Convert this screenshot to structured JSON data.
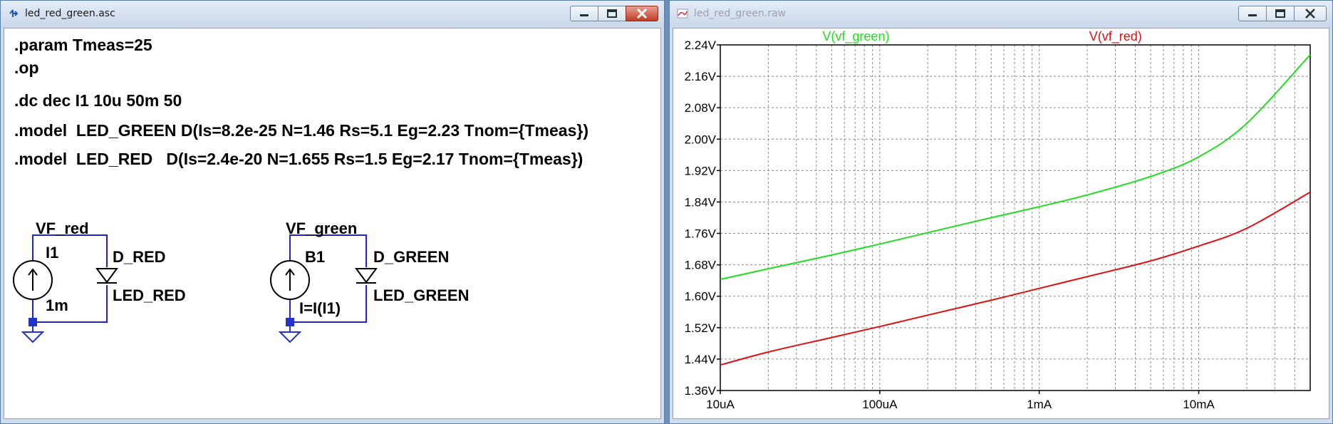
{
  "schematic_window": {
    "title": "led_red_green.asc",
    "directives": [
      ".param Tmeas=25",
      ".op",
      ".dc dec I1 10u 50m 50",
      ".model  LED_GREEN D(Is=8.2e-25 N=1.46 Rs=5.1 Eg=2.23 Tnom={Tmeas})",
      ".model  LED_RED   D(Is=2.4e-20 N=1.655 Rs=1.5 Eg=2.17 Tnom={Tmeas})"
    ],
    "circuit_red": {
      "net_label": "VF_red",
      "source_name": "I1",
      "source_value": "1m",
      "diode_name": "D_RED",
      "diode_model": "LED_RED"
    },
    "circuit_green": {
      "net_label": "VF_green",
      "source_name": "B1",
      "source_value": "I=I(I1)",
      "diode_name": "D_GREEN",
      "diode_model": "LED_GREEN"
    },
    "wire_color": "#2222cc"
  },
  "plot_window": {
    "title": "led_red_green.raw"
  },
  "chart_data": {
    "type": "line",
    "xscale": "log",
    "xlim": [
      1e-05,
      0.05
    ],
    "ylim": [
      1.36,
      2.24
    ],
    "xticks": [
      1e-05,
      0.0001,
      0.001,
      0.01
    ],
    "xtick_labels": [
      "10uA",
      "100uA",
      "1mA",
      "10mA"
    ],
    "yticks": [
      1.36,
      1.44,
      1.52,
      1.6,
      1.68,
      1.76,
      1.84,
      1.92,
      2.0,
      2.08,
      2.16,
      2.24
    ],
    "ytick_labels": [
      "1.36V",
      "1.44V",
      "1.52V",
      "1.60V",
      "1.68V",
      "1.76V",
      "1.84V",
      "1.92V",
      "2.00V",
      "2.08V",
      "2.16V",
      "2.24V"
    ],
    "grid": true,
    "series": [
      {
        "name": "V(vf_green)",
        "color": "#22dd22",
        "x": [
          1e-05,
          2e-05,
          5e-05,
          0.0001,
          0.0002,
          0.0005,
          0.001,
          0.002,
          0.005,
          0.01,
          0.02,
          0.05
        ],
        "y": [
          1.643,
          1.67,
          1.705,
          1.733,
          1.762,
          1.8,
          1.828,
          1.858,
          1.905,
          1.955,
          2.04,
          2.215
        ]
      },
      {
        "name": "V(vf_red)",
        "color": "#dd1111",
        "x": [
          1e-05,
          2e-05,
          5e-05,
          0.0001,
          0.0002,
          0.0005,
          0.001,
          0.002,
          0.005,
          0.01,
          0.02,
          0.05
        ],
        "y": [
          1.425,
          1.458,
          1.495,
          1.523,
          1.552,
          1.59,
          1.62,
          1.65,
          1.69,
          1.728,
          1.773,
          1.865
        ]
      }
    ]
  }
}
